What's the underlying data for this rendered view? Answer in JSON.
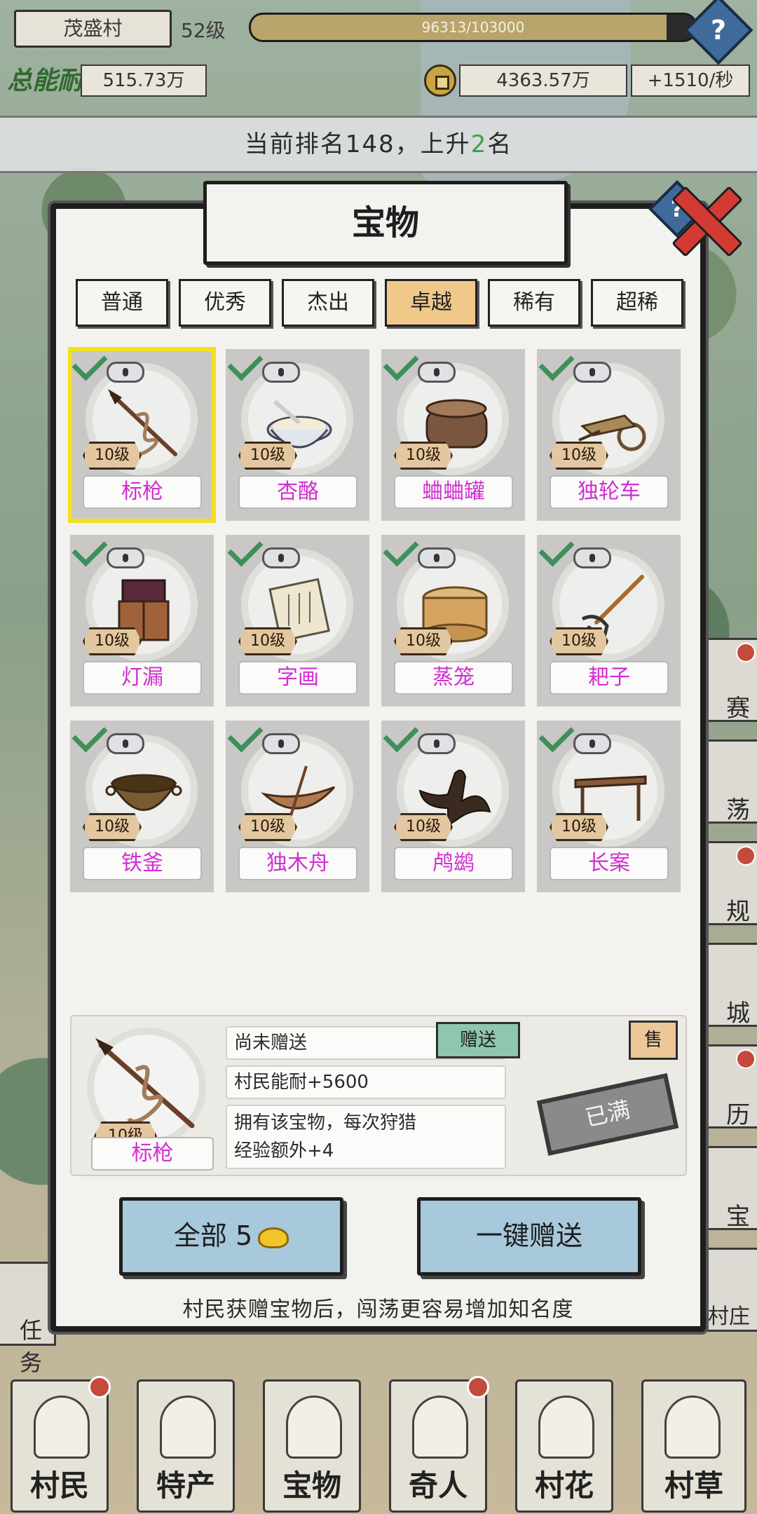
{
  "hud": {
    "village_name": "茂盛村",
    "village_level": "52级",
    "exp_text": "96313/103000",
    "exp_fraction": 0.935,
    "total_label": "总能耐",
    "total_value": "515.73万",
    "coin_value": "4363.57万",
    "coin_rate": "+1510/秒",
    "help_symbol": "?"
  },
  "rank_banner": {
    "prefix": "当前排名148，上升",
    "rise": "2",
    "suffix": "名"
  },
  "modal": {
    "title": "宝物",
    "help_symbol": "?",
    "tabs": [
      {
        "label": "普通"
      },
      {
        "label": "优秀"
      },
      {
        "label": "杰出"
      },
      {
        "label": "卓越"
      },
      {
        "label": "稀有"
      },
      {
        "label": "超稀"
      }
    ],
    "active_tab": "卓越",
    "items": [
      {
        "name": "标枪",
        "level": "10级",
        "icon": "spear-icon",
        "selected": true
      },
      {
        "name": "杏酪",
        "level": "10级",
        "icon": "bowl-icon"
      },
      {
        "name": "蛐蛐罐",
        "level": "10级",
        "icon": "cricket-jar-icon"
      },
      {
        "name": "独轮车",
        "level": "10级",
        "icon": "wheelbarrow-icon"
      },
      {
        "name": "灯漏",
        "level": "10级",
        "icon": "lamp-clock-icon"
      },
      {
        "name": "字画",
        "level": "10级",
        "icon": "scroll-icon"
      },
      {
        "name": "蒸笼",
        "level": "10级",
        "icon": "steamer-icon"
      },
      {
        "name": "耙子",
        "level": "10级",
        "icon": "rake-icon"
      },
      {
        "name": "铁釜",
        "level": "10级",
        "icon": "cauldron-icon"
      },
      {
        "name": "独木舟",
        "level": "10级",
        "icon": "canoe-icon"
      },
      {
        "name": "鸬鹚",
        "level": "10级",
        "icon": "cormorant-icon"
      },
      {
        "name": "长案",
        "level": "10级",
        "icon": "long-table-icon"
      }
    ],
    "detail": {
      "name": "标枪",
      "level": "10级",
      "status": "尚未赠送",
      "gift_label": "赠送",
      "sell_label": "售",
      "stat": "村民能耐+5600",
      "desc_line1": "拥有该宝物，每次狩猎",
      "desc_line2": "经验额外+4",
      "stamp": "已满"
    },
    "unlock_all_label": "全部",
    "unlock_all_cost": "5",
    "gift_all_label": "一键赠送",
    "footer_note": "村民获赠宝物后，闯荡更容易增加知名度"
  },
  "side_right": [
    {
      "label": "赛"
    },
    {
      "label": "荡"
    },
    {
      "label": "规"
    },
    {
      "label": "城"
    },
    {
      "label": "历"
    },
    {
      "label": "宝"
    },
    {
      "label": "村庄"
    }
  ],
  "side_left": [
    {
      "label": "任务"
    }
  ],
  "bottom_nav": [
    {
      "label": "村民",
      "dot": true
    },
    {
      "label": "特产"
    },
    {
      "label": "宝物"
    },
    {
      "label": "奇人",
      "dot": true
    },
    {
      "label": "村花"
    },
    {
      "label": "村草"
    }
  ],
  "colors": {
    "accent_purple": "#d12fd1",
    "tab_active": "#f0c98a",
    "selected_outline": "#f2e01d",
    "rank_up_green": "#37a14a",
    "close_red": "#d23a34"
  }
}
